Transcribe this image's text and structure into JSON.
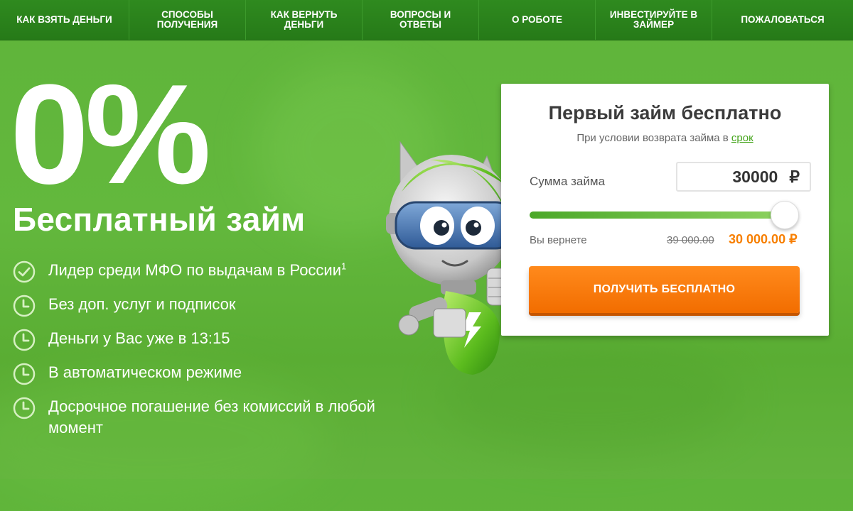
{
  "nav": {
    "items": [
      {
        "label": "КАК ВЗЯТЬ ДЕНЬГИ"
      },
      {
        "label": "СПОСОБЫ\nПОЛУЧЕНИЯ"
      },
      {
        "label": "КАК ВЕРНУТЬ\nДЕНЬГИ"
      },
      {
        "label": "ВОПРОСЫ И\nОТВЕТЫ"
      },
      {
        "label": "О РОБОТЕ"
      },
      {
        "label": "ИНВЕСТИРУЙТЕ В\nЗАЙМЕР"
      },
      {
        "label": "ПОЖАЛОВАТЬСЯ"
      }
    ]
  },
  "hero": {
    "big": "0%",
    "title": "Бесплатный займ",
    "features": [
      {
        "text": "Лидер среди МФО по выдачам в России",
        "sup": "1",
        "icon": "check-circle-icon"
      },
      {
        "text": "Без доп. услуг и подписок",
        "icon": "clock-icon"
      },
      {
        "text": "Деньги у Вас уже в 13:15",
        "icon": "clock-icon"
      },
      {
        "text": "В автоматическом режиме",
        "icon": "clock-icon"
      },
      {
        "text": "Досрочное погашение без комиссий в любой момент",
        "icon": "clock-icon"
      }
    ]
  },
  "card": {
    "title": "Первый займ бесплатно",
    "subtitle_prefix": "При условии возврата займа в",
    "subtitle_link": "срок",
    "sum_label": "Сумма займа",
    "sum_value": "30000",
    "currency": "₽",
    "slider_fraction": 1.0,
    "return_label": "Вы вернете",
    "old_price": "39 000.00",
    "new_price": "30 000.00 ₽",
    "cta": "ПОЛУЧИТЬ БЕСПЛАТНО"
  },
  "colors": {
    "brand_green": "#5fb43a",
    "nav_green": "#2f8a1f",
    "accent_orange": "#f77f00",
    "link_green": "#46a51d"
  }
}
